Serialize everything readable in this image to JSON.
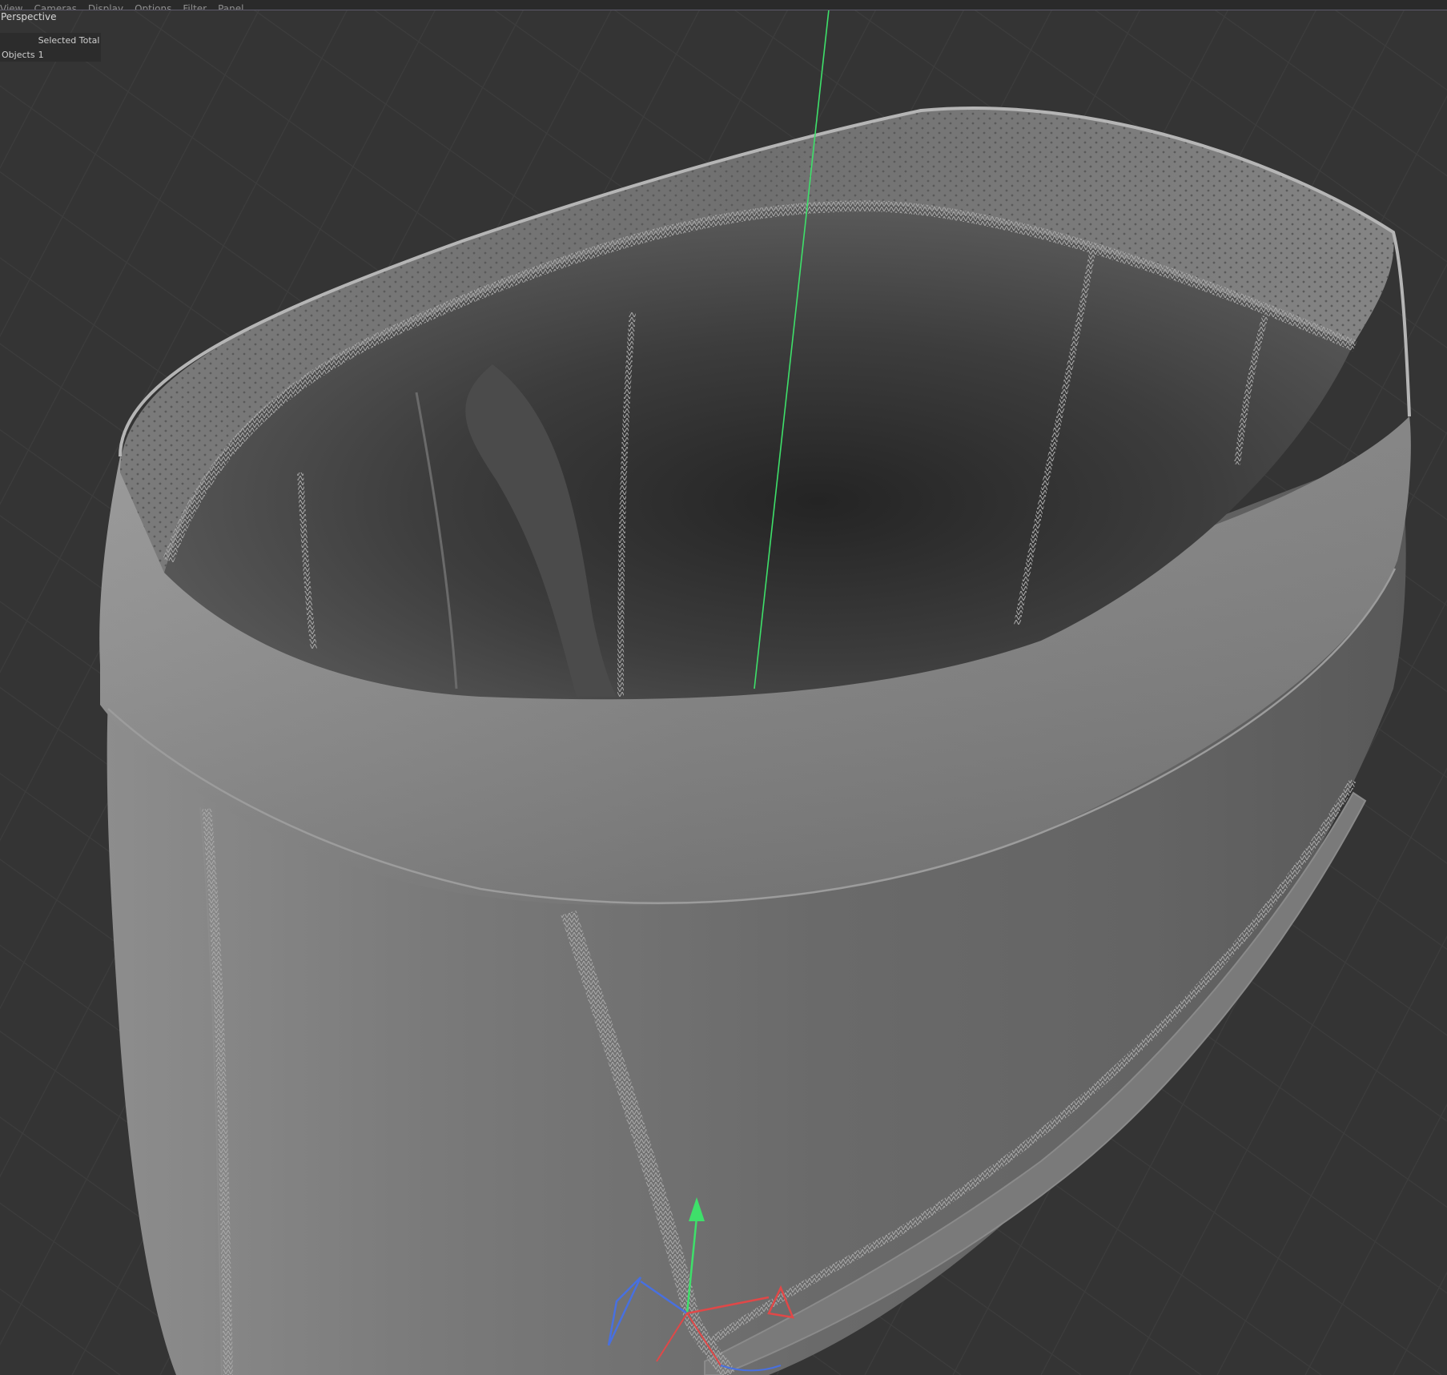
{
  "menubar": {
    "items": [
      "View",
      "Cameras",
      "Display",
      "Options",
      "Filter",
      "Panel"
    ]
  },
  "viewport": {
    "view_name": "Perspective"
  },
  "info_panel": {
    "header_blank": "",
    "header": "Selected Total",
    "rows": [
      {
        "label": "Objects",
        "value": "1"
      }
    ]
  },
  "colors": {
    "background": "#343434",
    "grid_line": "#3b3b3b",
    "axis_y": "#3ee06a",
    "axis_x": "#e04848",
    "axis_z": "#4870e0",
    "mesh_base": "#6d6d6d",
    "menubar_border": "#5e5b6c"
  },
  "icons": {
    "gizmo": "move-gizmo-icon"
  }
}
